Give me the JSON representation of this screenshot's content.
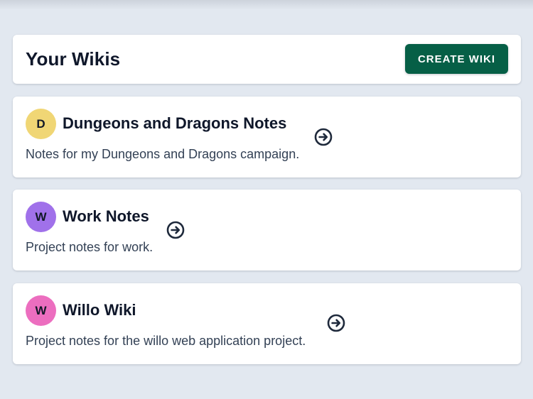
{
  "header": {
    "title": "Your Wikis",
    "create_button_label": "CREATE WIKI"
  },
  "wikis": [
    {
      "initial": "D",
      "title": "Dungeons and Dragons Notes",
      "description": "Notes for my Dungeons and Dragons campaign.",
      "avatar_color": "#f0d675",
      "icon": "arrow-circle-right-icon"
    },
    {
      "initial": "W",
      "title": "Work Notes",
      "description": "Project notes for work.",
      "avatar_color": "#a071ea",
      "icon": "arrow-circle-right-icon"
    },
    {
      "initial": "W",
      "title": "Willo Wiki",
      "description": "Project notes for the willo web application project.",
      "avatar_color": "#ec6ebf",
      "icon": "arrow-circle-right-icon"
    }
  ],
  "colors": {
    "background": "#e2e8f0",
    "card": "#ffffff",
    "primary_button": "#065f46",
    "text_primary": "#0f172a",
    "text_secondary": "#334155"
  }
}
